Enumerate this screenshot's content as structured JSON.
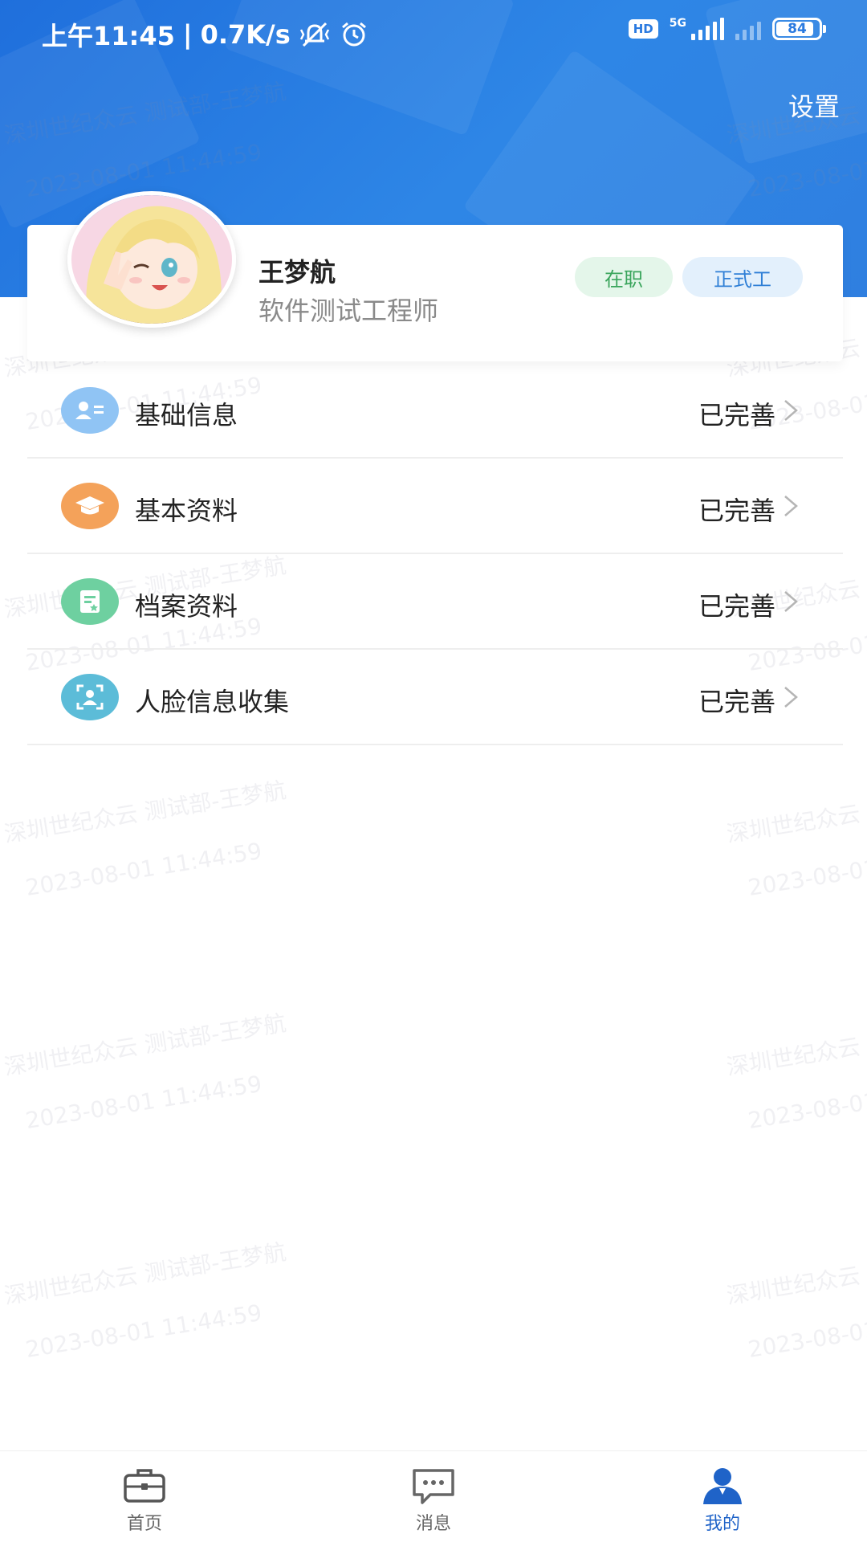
{
  "status_bar": {
    "time": "上午11:45",
    "speed": "0.7K/s",
    "network_badge": "HD",
    "network_type": "5G",
    "battery": "84"
  },
  "header": {
    "settings_label": "设置",
    "background_color": "#2a7ae0"
  },
  "profile": {
    "name": "王梦航",
    "job_title": "软件测试工程师",
    "avatar": "avatar-image",
    "badges": [
      {
        "label": "在职",
        "color": "#3aa55c"
      },
      {
        "label": "正式工",
        "color": "#2f7fd6"
      }
    ]
  },
  "menu": [
    {
      "label": "基础信息",
      "status": "已完善",
      "icon": "id-card-icon",
      "icon_color": "#90c4f4"
    },
    {
      "label": "基本资料",
      "status": "已完善",
      "icon": "graduation-cap-icon",
      "icon_color": "#f4a25a"
    },
    {
      "label": "档案资料",
      "status": "已完善",
      "icon": "document-icon",
      "icon_color": "#6ed0a0"
    },
    {
      "label": "人脸信息收集",
      "status": "已完善",
      "icon": "face-scan-icon",
      "icon_color": "#5cbcd8"
    }
  ],
  "watermark": {
    "line1": "深圳世纪众云 测试部-王梦航",
    "line2": "2023-08-01 11:44:59"
  },
  "tab_bar": {
    "tabs": [
      {
        "label": "首页",
        "icon": "briefcase-icon",
        "active": false
      },
      {
        "label": "消息",
        "icon": "chat-bubble-icon",
        "active": false
      },
      {
        "label": "我的",
        "icon": "person-icon",
        "active": true
      }
    ],
    "active_color": "#1f63c8"
  }
}
